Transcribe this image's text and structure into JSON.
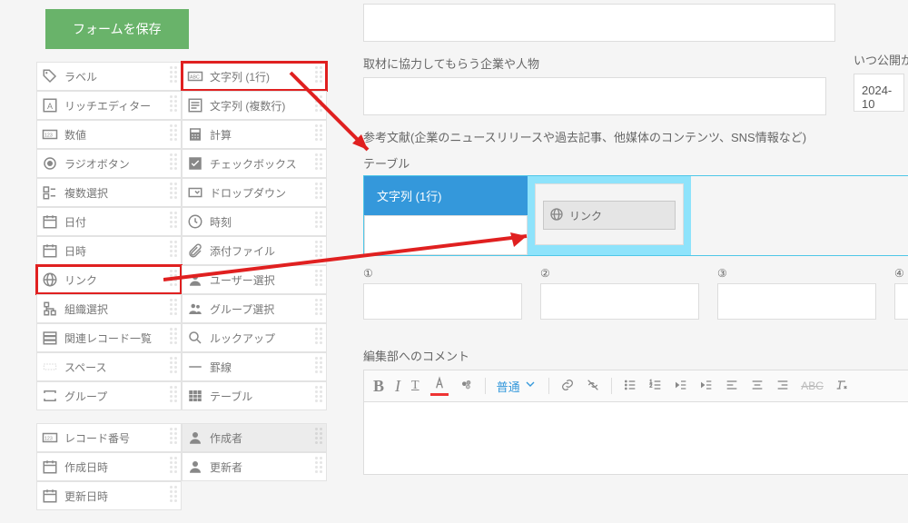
{
  "sidebar": {
    "save_btn": "フォームを保存",
    "items_left": [
      {
        "icon": "tag",
        "label": "ラベル"
      },
      {
        "icon": "A",
        "label": "リッチエディター"
      },
      {
        "icon": "123",
        "label": "数値"
      },
      {
        "icon": "radio",
        "label": "ラジオボタン"
      },
      {
        "icon": "multi",
        "label": "複数選択"
      },
      {
        "icon": "cal",
        "label": "日付"
      },
      {
        "icon": "cal",
        "label": "日時"
      },
      {
        "icon": "globe",
        "label": "リンク",
        "hl": true
      },
      {
        "icon": "org",
        "label": "組織選択"
      },
      {
        "icon": "rel",
        "label": "関連レコード一覧"
      },
      {
        "icon": "space",
        "label": "スペース"
      },
      {
        "icon": "group",
        "label": "グループ"
      }
    ],
    "items_right": [
      {
        "icon": "ABC",
        "label": "文字列 (1行)",
        "hl": true
      },
      {
        "icon": "lines",
        "label": "文字列 (複数行)"
      },
      {
        "icon": "calc",
        "label": "計算"
      },
      {
        "icon": "check",
        "label": "チェックボックス"
      },
      {
        "icon": "dd",
        "label": "ドロップダウン"
      },
      {
        "icon": "clock",
        "label": "時刻"
      },
      {
        "icon": "clip",
        "label": "添付ファイル"
      },
      {
        "icon": "user",
        "label": "ユーザー選択"
      },
      {
        "icon": "users",
        "label": "グループ選択"
      },
      {
        "icon": "lookup",
        "label": "ルックアップ"
      },
      {
        "icon": "line",
        "label": "罫線"
      },
      {
        "icon": "table",
        "label": "テーブル"
      }
    ],
    "items_bottom_left": [
      {
        "icon": "123",
        "label": "レコード番号"
      },
      {
        "icon": "cal",
        "label": "作成日時"
      },
      {
        "icon": "cal",
        "label": "更新日時"
      }
    ],
    "items_bottom_right": [
      {
        "icon": "user",
        "label": "作成者",
        "disabled": true
      },
      {
        "icon": "user",
        "label": "更新者"
      }
    ]
  },
  "main": {
    "field1_label": "取材に協力してもらう企業や人物",
    "ref_label": "参考文献(企業のニュースリリースや過去記事、他媒体のコンテンツ、SNS情報など)",
    "table_title": "テーブル",
    "table_header": "文字列 (1行)",
    "drop_label": "リンク",
    "cols": [
      "①",
      "②",
      "③",
      "④"
    ],
    "comment_label": "編集部へのコメント",
    "toolbar_normal": "普通"
  },
  "right": {
    "label": "いつ公開か",
    "value": "2024-10"
  }
}
